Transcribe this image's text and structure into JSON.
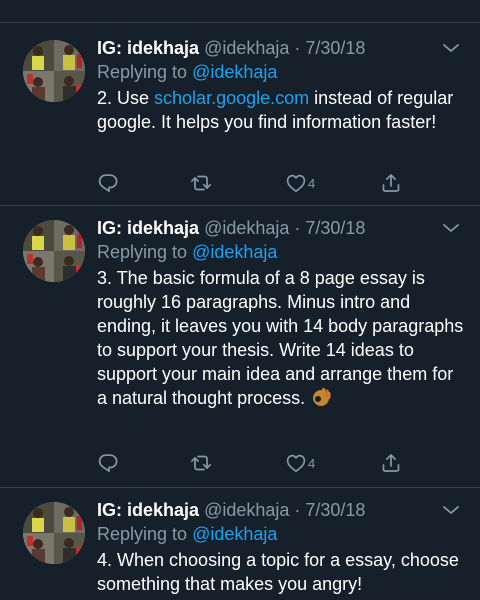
{
  "tweets": [
    {
      "display_name": "IG: idekhaja",
      "meta": "@idekhaja · 7/30/18",
      "replying_prefix": "Replying to ",
      "replying_handle": "@idekhaja",
      "body_before_link": "2. Use ",
      "body_link": "scholar.google.com",
      "body_after_link": " instead of regular google. It helps you find information faster!",
      "like_count": "4"
    },
    {
      "display_name": "IG: idekhaja",
      "meta": "@idekhaja · 7/30/18",
      "replying_prefix": "Replying to ",
      "replying_handle": "@idekhaja",
      "body": "3. The basic formula of a 8 page essay is roughly 16 paragraphs. Minus intro and ending, it leaves you with 14 body paragraphs to support your thesis. Write 14 ideas to support your main idea and arrange them for a natural thought process.",
      "body_emoji": "ok-hand-emoji",
      "like_count": "4"
    },
    {
      "display_name": "IG: idekhaja",
      "meta": "@idekhaja · 7/30/18",
      "replying_prefix": "Replying to ",
      "replying_handle": "@idekhaja",
      "body": "4. When choosing a topic for a essay, choose something that makes you angry!"
    }
  ],
  "icons": {
    "reply": "reply-icon",
    "retweet": "retweet-icon",
    "like": "heart-icon",
    "share": "share-icon",
    "more": "chevron-down-icon"
  },
  "colors": {
    "background": "#15202b",
    "divider": "#38444d",
    "secondary_text": "#8899a6",
    "link": "#1da1f2"
  }
}
